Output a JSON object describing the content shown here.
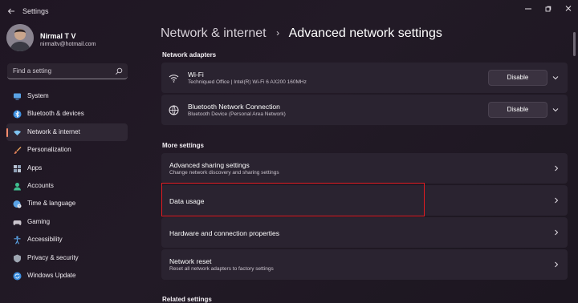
{
  "window": {
    "title": "Settings"
  },
  "profile": {
    "name": "Nirmal T V",
    "email": "nirmaltv@hotmail.com"
  },
  "search": {
    "placeholder": "Find a setting"
  },
  "sidebar": {
    "items": [
      {
        "label": "System",
        "icon": "system-icon",
        "color": "#5aa3e6"
      },
      {
        "label": "Bluetooth & devices",
        "icon": "bluetooth-icon",
        "color": "#3d8fe0"
      },
      {
        "label": "Network & internet",
        "icon": "wifi-icon",
        "color": "#7fc3f0",
        "active": true
      },
      {
        "label": "Personalization",
        "icon": "brush-icon",
        "color": "#e8a05a"
      },
      {
        "label": "Apps",
        "icon": "apps-icon",
        "color": "#b9c3d2"
      },
      {
        "label": "Accounts",
        "icon": "accounts-icon",
        "color": "#3fbf8f"
      },
      {
        "label": "Time & language",
        "icon": "globe-clock-icon",
        "color": "#5aa3e6"
      },
      {
        "label": "Gaming",
        "icon": "gaming-icon",
        "color": "#c9c3cc"
      },
      {
        "label": "Accessibility",
        "icon": "accessibility-icon",
        "color": "#5aa3e6"
      },
      {
        "label": "Privacy & security",
        "icon": "shield-icon",
        "color": "#9ea6b2"
      },
      {
        "label": "Windows Update",
        "icon": "update-icon",
        "color": "#3d8fe0"
      }
    ]
  },
  "breadcrumb": {
    "parent": "Network & internet",
    "separator": "›",
    "current": "Advanced network settings"
  },
  "network_adapters": {
    "label": "Network adapters",
    "adapters": [
      {
        "name": "Wi-Fi",
        "description": "Techniqued Office | Intel(R) Wi-Fi 6 AX200 160MHz",
        "button": "Disable",
        "icon": "wifi-icon"
      },
      {
        "name": "Bluetooth Network Connection",
        "description": "Bluetooth Device (Personal Area Network)",
        "button": "Disable",
        "icon": "network-globe-icon"
      }
    ]
  },
  "more_settings": {
    "label": "More settings",
    "items": [
      {
        "title": "Advanced sharing settings",
        "subtitle": "Change network discovery and sharing settings"
      },
      {
        "title": "Data usage",
        "subtitle": ""
      },
      {
        "title": "Hardware and connection properties",
        "subtitle": ""
      },
      {
        "title": "Network reset",
        "subtitle": "Reset all network adapters to factory settings"
      }
    ]
  },
  "related_settings": {
    "label": "Related settings"
  },
  "colors": {
    "accent": "#ff8d6e",
    "highlight_border": "#e01c22",
    "card": "#2a2330"
  }
}
